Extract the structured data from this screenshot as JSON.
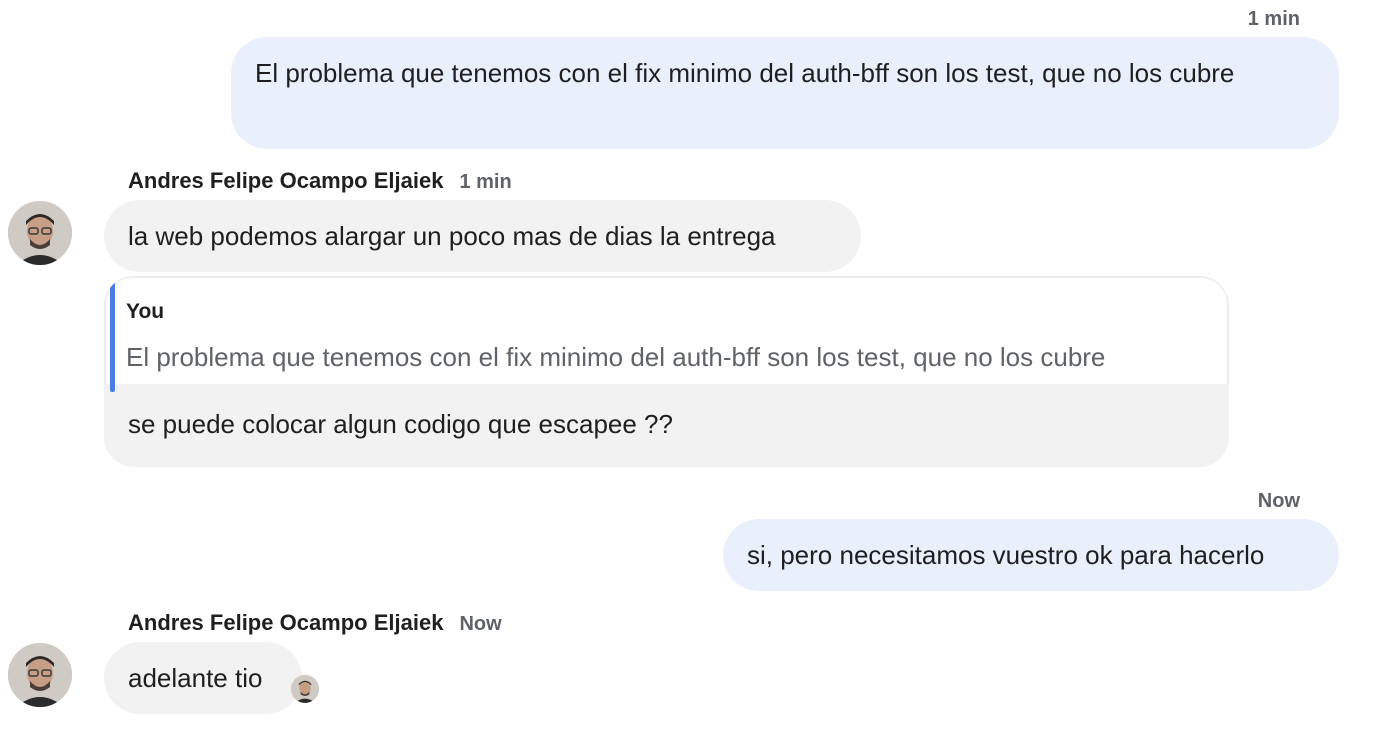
{
  "messages": {
    "m1": {
      "time": "1 min",
      "text": "El problema que tenemos con el fix minimo del auth-bff son los test, que no los cubre"
    },
    "m2": {
      "sender": "Andres Felipe Ocampo Eljaiek",
      "time": "1 min",
      "text": "la web podemos alargar un poco mas de dias la entrega"
    },
    "m3": {
      "quote_author": "You",
      "quote_text": "El problema que tenemos con el fix minimo del auth-bff son los test, que no los cubre",
      "text": "se puede colocar algun codigo que escapee ??"
    },
    "m4": {
      "time": "Now",
      "text": "si, pero necesitamos vuestro ok para hacerlo"
    },
    "m5": {
      "sender": "Andres Felipe Ocampo Eljaiek",
      "time": "Now",
      "text": "adelante tio"
    }
  },
  "colors": {
    "outgoing_bubble": "#e9f0fc",
    "incoming_bubble": "#f2f2f2",
    "quote_bar": "#4a7de6",
    "muted_text": "#5f6368"
  },
  "icons": {
    "avatar": "avatar",
    "read_receipt": "read-receipt-avatar"
  }
}
